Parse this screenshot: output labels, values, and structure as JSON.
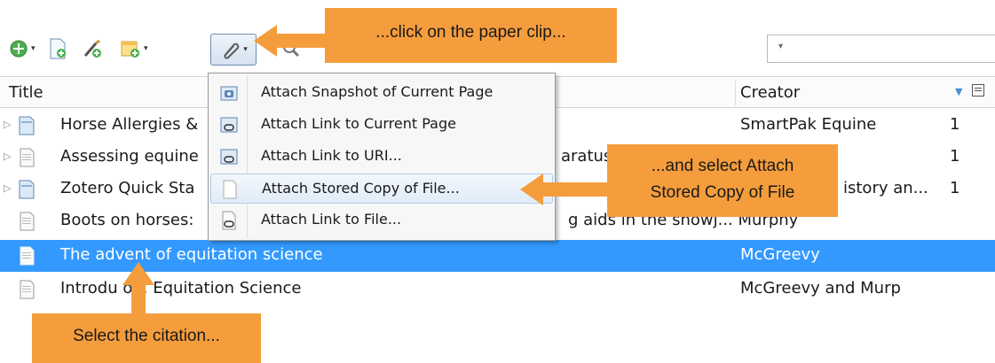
{
  "toolbar": {
    "buttons": [
      {
        "name": "new-item-icon",
        "dropdown": true
      },
      {
        "name": "new-item-from-page-icon",
        "dropdown": false
      },
      {
        "name": "add-by-identifier-icon",
        "dropdown": false
      },
      {
        "name": "new-note-icon",
        "dropdown": true
      },
      {
        "name": "paperclip-icon",
        "dropdown": true
      },
      {
        "name": "magnifier-icon",
        "dropdown": false
      }
    ],
    "search_placeholder": ""
  },
  "table": {
    "columns": {
      "title": "Title",
      "creator": "Creator"
    },
    "rows": [
      {
        "title": "Horse Allergies & ",
        "creator": "SmartPak Equine",
        "count": "1",
        "type": "web-page",
        "expandable": true,
        "selected": false
      },
      {
        "title": "Assessing equine",
        "creator": "aratus",
        "count": "1",
        "type": "document",
        "expandable": true,
        "selected": false
      },
      {
        "title": "Zotero Quick Sta",
        "creator": "istory an...",
        "count": "1",
        "type": "web-page",
        "expandable": true,
        "selected": false
      },
      {
        "title": "Boots on horses:",
        "creator": "g aids in the snowj... Murphy",
        "count": "",
        "type": "document",
        "expandable": false,
        "selected": false
      },
      {
        "title": "The advent of equitation science",
        "creator": "McGreevy",
        "count": "",
        "type": "document",
        "expandable": false,
        "selected": true
      },
      {
        "title": "Introdu    on. Equitation Science",
        "creator": "McGreevy and Murp",
        "count": "",
        "type": "document",
        "expandable": false,
        "selected": false
      }
    ]
  },
  "menu": {
    "items": [
      {
        "label": "Attach Snapshot of Current Page",
        "icon": "snapshot-icon",
        "highlighted": false
      },
      {
        "label": "Attach Link to Current Page",
        "icon": "link-page-icon",
        "highlighted": false
      },
      {
        "label": "Attach Link to URI...",
        "icon": "link-uri-icon",
        "highlighted": false
      },
      {
        "label": "Attach Stored Copy of File...",
        "icon": "stored-file-icon",
        "highlighted": true
      },
      {
        "label": "Attach Link to File...",
        "icon": "link-file-icon",
        "highlighted": false
      }
    ]
  },
  "callouts": {
    "paperclip": "...click on the paper clip...",
    "attach_line1": "...and select Attach",
    "attach_line2": "Stored Copy of File",
    "citation": "Select the citation..."
  },
  "colors": {
    "callout": "#f59d3d",
    "selection": "#3399ff",
    "menu_highlight": "#e1ecf8"
  }
}
